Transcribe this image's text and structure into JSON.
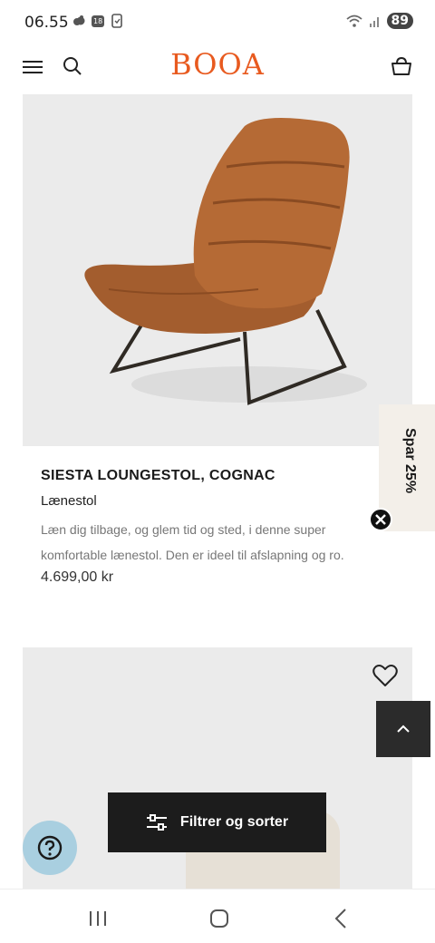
{
  "status_bar": {
    "time": "06.55",
    "calendar_badge": "18",
    "battery": "89"
  },
  "header": {
    "logo": "BOOA",
    "brand_color": "#e85a1f"
  },
  "product1": {
    "title": "SIESTA LOUNGESTOL, COGNAC",
    "category": "Lænestol",
    "description": "Læn dig tilbage, og glem tid og sted, i denne super komfortable lænestol. Den er ideel til afslapning og ro.",
    "price": "4.699,00 kr",
    "image_icon": "lounge-chair-image"
  },
  "promo": {
    "label": "Spar 25%"
  },
  "filter": {
    "label": "Filtrer og sorter"
  },
  "icons": {
    "menu": "hamburger-icon",
    "search": "search-icon",
    "basket": "basket-icon",
    "close": "close-icon",
    "favorite": "heart-icon",
    "scroll_top": "chevron-up-icon",
    "filter": "sliders-icon",
    "help": "question-icon"
  },
  "colors": {
    "accent": "#e85a1f",
    "dark_button": "#1c1c1c",
    "help_button": "#a9cfe0",
    "promo_bg": "#f3efe9",
    "image_bg": "#ebebeb"
  }
}
